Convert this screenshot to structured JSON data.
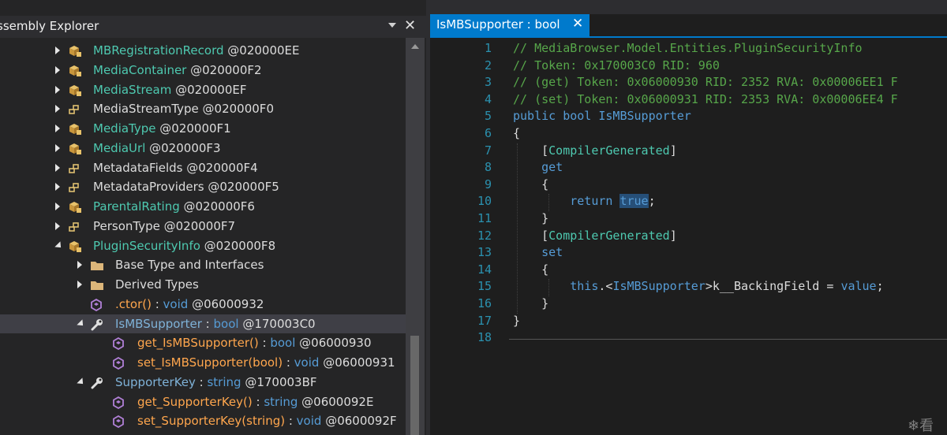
{
  "left_panel": {
    "title": "ssembly Explorer",
    "tree": [
      {
        "indent": 0,
        "exp": "collapsed",
        "icon": "class",
        "name": "MBRegistrationRecord",
        "type": "",
        "token": "@020000EE"
      },
      {
        "indent": 0,
        "exp": "collapsed",
        "icon": "class",
        "name": "MediaContainer",
        "type": "",
        "token": "@020000F2"
      },
      {
        "indent": 0,
        "exp": "collapsed",
        "icon": "class",
        "name": "MediaStream",
        "type": "",
        "token": "@020000EF"
      },
      {
        "indent": 0,
        "exp": "collapsed",
        "icon": "enum",
        "name": "MediaStreamType",
        "type": "",
        "token": "@020000F0"
      },
      {
        "indent": 0,
        "exp": "collapsed",
        "icon": "class",
        "name": "MediaType",
        "type": "",
        "token": "@020000F1"
      },
      {
        "indent": 0,
        "exp": "collapsed",
        "icon": "class",
        "name": "MediaUrl",
        "type": "",
        "token": "@020000F3"
      },
      {
        "indent": 0,
        "exp": "collapsed",
        "icon": "enum",
        "name": "MetadataFields",
        "type": "",
        "token": "@020000F4"
      },
      {
        "indent": 0,
        "exp": "collapsed",
        "icon": "enum",
        "name": "MetadataProviders",
        "type": "",
        "token": "@020000F5"
      },
      {
        "indent": 0,
        "exp": "collapsed",
        "icon": "class",
        "name": "ParentalRating",
        "type": "",
        "token": "@020000F6"
      },
      {
        "indent": 0,
        "exp": "collapsed",
        "icon": "enum",
        "name": "PersonType",
        "type": "",
        "token": "@020000F7"
      },
      {
        "indent": 0,
        "exp": "expanded",
        "icon": "class",
        "name": "PluginSecurityInfo",
        "type": "",
        "token": "@020000F8"
      },
      {
        "indent": 1,
        "exp": "collapsed",
        "icon": "folder",
        "name": "Base Type and Interfaces",
        "type": "",
        "token": ""
      },
      {
        "indent": 1,
        "exp": "collapsed",
        "icon": "folder",
        "name": "Derived Types",
        "type": "",
        "token": ""
      },
      {
        "indent": 1,
        "exp": "none",
        "icon": "method",
        "name": ".ctor()",
        "type": "void",
        "token": "@06000932"
      },
      {
        "indent": 1,
        "exp": "expanded",
        "icon": "property",
        "name": "IsMBSupporter",
        "type": "bool",
        "token": "@170003C0",
        "selected": true
      },
      {
        "indent": 2,
        "exp": "none",
        "icon": "method",
        "name": "get_IsMBSupporter()",
        "type": "bool",
        "token": "@06000930"
      },
      {
        "indent": 2,
        "exp": "none",
        "icon": "method",
        "name": "set_IsMBSupporter(bool)",
        "type": "void",
        "token": "@06000931"
      },
      {
        "indent": 1,
        "exp": "expanded",
        "icon": "property",
        "name": "SupporterKey",
        "type": "string",
        "token": "@170003BF"
      },
      {
        "indent": 2,
        "exp": "none",
        "icon": "method",
        "name": "get_SupporterKey()",
        "type": "string",
        "token": "@0600092E"
      },
      {
        "indent": 2,
        "exp": "none",
        "icon": "method",
        "name": "set_SupporterKey(string)",
        "type": "void",
        "token": "@0600092F"
      }
    ]
  },
  "editor": {
    "tab_title": "IsMBSupporter : bool",
    "lines": [
      {
        "n": "1",
        "tokens": [
          {
            "t": "// MediaBrowser.Model.Entities.PluginSecurityInfo",
            "c": "com"
          }
        ]
      },
      {
        "n": "2",
        "tokens": [
          {
            "t": "// Token: 0x170003C0 RID: 960",
            "c": "com"
          }
        ]
      },
      {
        "n": "3",
        "tokens": [
          {
            "t": "// (get) Token: 0x06000930 RID: 2352 RVA: 0x00006EE1 F",
            "c": "com"
          }
        ]
      },
      {
        "n": "4",
        "tokens": [
          {
            "t": "// (set) Token: 0x06000931 RID: 2353 RVA: 0x00006EE4 F",
            "c": "com"
          }
        ]
      },
      {
        "n": "5",
        "tokens": [
          {
            "t": "public bool ",
            "c": "kw"
          },
          {
            "t": "IsMBSupporter",
            "c": "prop"
          }
        ]
      },
      {
        "n": "6",
        "tokens": [
          {
            "t": "{",
            "c": ""
          }
        ]
      },
      {
        "n": "7",
        "tokens": [
          {
            "t": "    [",
            "c": ""
          },
          {
            "t": "CompilerGenerated",
            "c": "attr"
          },
          {
            "t": "]",
            "c": ""
          }
        ]
      },
      {
        "n": "8",
        "tokens": [
          {
            "t": "    ",
            "c": ""
          },
          {
            "t": "get",
            "c": "kw"
          }
        ]
      },
      {
        "n": "9",
        "tokens": [
          {
            "t": "    {",
            "c": ""
          }
        ]
      },
      {
        "n": "10",
        "tokens": [
          {
            "t": "        ",
            "c": ""
          },
          {
            "t": "return ",
            "c": "kw"
          },
          {
            "t": "true",
            "c": "kw sel"
          },
          {
            "t": ";",
            "c": ""
          }
        ]
      },
      {
        "n": "11",
        "tokens": [
          {
            "t": "    }",
            "c": ""
          }
        ]
      },
      {
        "n": "12",
        "tokens": [
          {
            "t": "    [",
            "c": ""
          },
          {
            "t": "CompilerGenerated",
            "c": "attr"
          },
          {
            "t": "]",
            "c": ""
          }
        ]
      },
      {
        "n": "13",
        "tokens": [
          {
            "t": "    ",
            "c": ""
          },
          {
            "t": "set",
            "c": "kw"
          }
        ]
      },
      {
        "n": "14",
        "tokens": [
          {
            "t": "    {",
            "c": ""
          }
        ]
      },
      {
        "n": "15",
        "tokens": [
          {
            "t": "        ",
            "c": ""
          },
          {
            "t": "this",
            "c": "kw"
          },
          {
            "t": ".<",
            "c": ""
          },
          {
            "t": "IsMBSupporter",
            "c": "prop"
          },
          {
            "t": ">k__BackingField = ",
            "c": ""
          },
          {
            "t": "value",
            "c": "kw"
          },
          {
            "t": ";",
            "c": ""
          }
        ]
      },
      {
        "n": "16",
        "tokens": [
          {
            "t": "    }",
            "c": ""
          }
        ]
      },
      {
        "n": "17",
        "tokens": [
          {
            "t": "}",
            "c": ""
          }
        ]
      },
      {
        "n": "18",
        "tokens": []
      }
    ]
  },
  "watermark": "❄看"
}
